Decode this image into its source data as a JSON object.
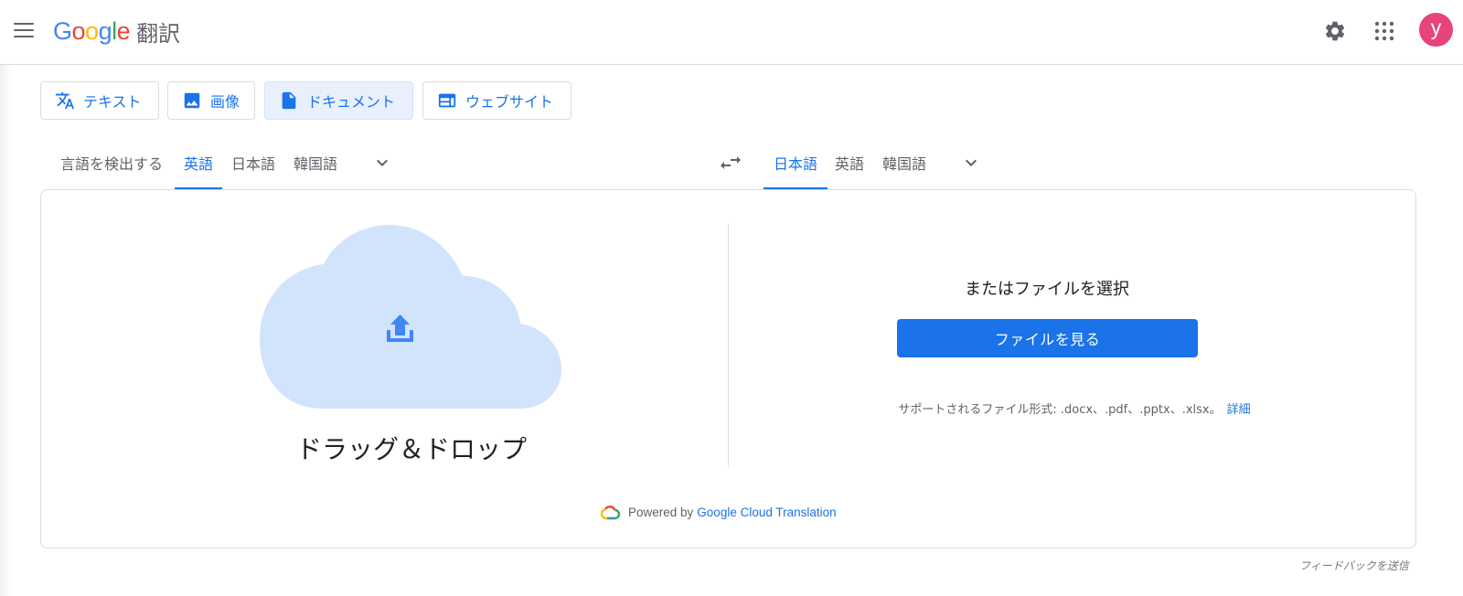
{
  "header": {
    "logo_letters": [
      {
        "ch": "G",
        "color": "#4285F4"
      },
      {
        "ch": "o",
        "color": "#EA4335"
      },
      {
        "ch": "o",
        "color": "#FBBC05"
      },
      {
        "ch": "g",
        "color": "#4285F4"
      },
      {
        "ch": "l",
        "color": "#34A853"
      },
      {
        "ch": "e",
        "color": "#EA4335"
      }
    ],
    "product": "翻訳",
    "avatar_letter": "y",
    "avatar_color": "#e8437b",
    "icons": [
      "menu-icon",
      "settings-icon",
      "apps-icon"
    ]
  },
  "mode_tabs": [
    {
      "label": "テキスト",
      "icon": "translate-icon"
    },
    {
      "label": "画像",
      "icon": "image-icon"
    },
    {
      "label": "ドキュメント",
      "icon": "document-icon",
      "active": true
    },
    {
      "label": "ウェブサイト",
      "icon": "website-icon"
    }
  ],
  "source_langs": [
    {
      "label": "言語を検出する"
    },
    {
      "label": "英語",
      "selected": true
    },
    {
      "label": "日本語"
    },
    {
      "label": "韓国語"
    }
  ],
  "target_langs": [
    {
      "label": "日本語",
      "selected": true
    },
    {
      "label": "英語"
    },
    {
      "label": "韓国語"
    }
  ],
  "upload": {
    "drop_text": "ドラッグ＆ドロップ",
    "choose_text": "またはファイルを選択",
    "browse_button": "ファイルを見る",
    "supported_text": "サポートされるファイル形式: .docx、.pdf、.pptx、.xlsx。",
    "details_link": "詳細"
  },
  "powered": {
    "prefix": "Powered by",
    "brand": "Google Cloud Translation"
  },
  "feedback": "フィードバックを送信",
  "colors": {
    "accent": "#1a73e8",
    "cloud": "#d2e3fc",
    "upload_arrow": "#4285f4"
  }
}
